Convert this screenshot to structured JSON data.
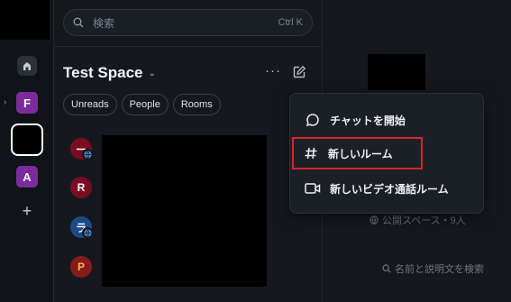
{
  "search": {
    "placeholder": "検索",
    "shortcut": "Ctrl K"
  },
  "space": {
    "title": "Test Space"
  },
  "filters": [
    "Unreads",
    "People",
    "Rooms"
  ],
  "rail": {
    "spaces": [
      "F",
      "A"
    ]
  },
  "rooms": [
    {
      "initial": "ー",
      "public": true
    },
    {
      "initial": "R",
      "public": false
    },
    {
      "initial": "ラ",
      "public": true
    },
    {
      "initial": "P",
      "public": false
    }
  ],
  "menu": {
    "items": [
      {
        "label": "チャットを開始",
        "icon": "chat-bubble-icon"
      },
      {
        "label": "新しいルーム",
        "icon": "hash-icon"
      },
      {
        "label": "新しいビデオ通話ルーム",
        "icon": "video-icon"
      }
    ]
  },
  "right": {
    "meta": "公開スペース・9人",
    "search_hint": "名前と説明文を検索"
  },
  "colors": {
    "highlight": "#e0202a",
    "space_avatar": "#7b2b9e"
  }
}
